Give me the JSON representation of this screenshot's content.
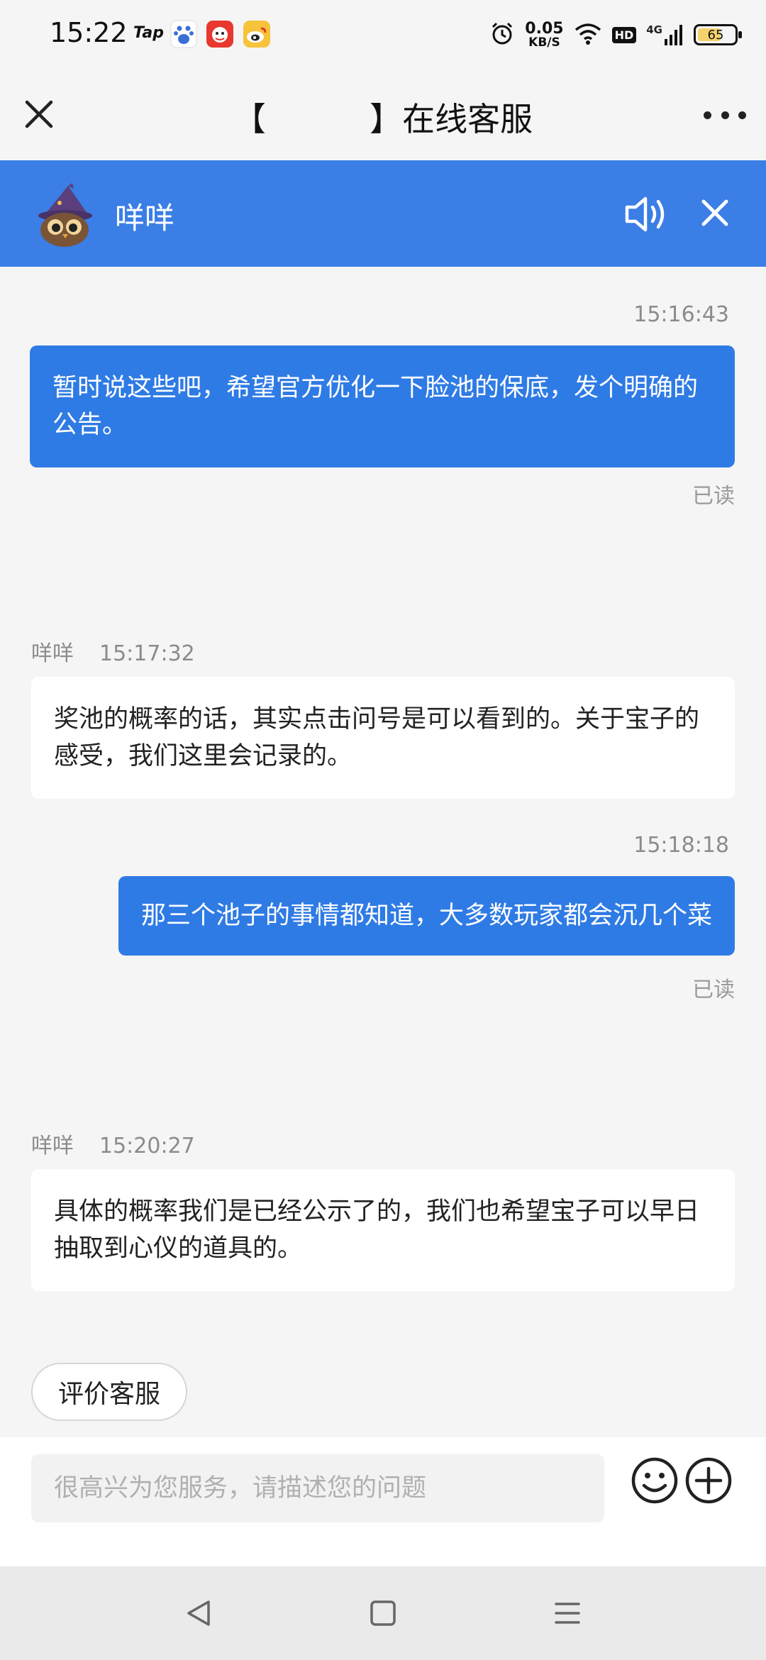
{
  "status_bar": {
    "time": "15:22",
    "tap_label": "Tap",
    "speed_value": "0.05",
    "speed_unit": "KB/S",
    "network": "4G",
    "hd_label": "HD",
    "battery": "65",
    "battery_level": 0.65
  },
  "title_bar": {
    "title": "【          】在线客服"
  },
  "agent": {
    "name": "咩咩"
  },
  "messages": [
    {
      "direction": "out",
      "time": "15:16:43",
      "text": "暂时说这些吧，希望官方优化一下脸池的保底，发个明确的公告。",
      "status": "已读"
    },
    {
      "direction": "in",
      "sender": "咩咩",
      "time": "15:17:32",
      "text": "奖池的概率的话，其实点击问号是可以看到的。关于宝子的感受，我们这里会记录的。"
    },
    {
      "direction": "out",
      "time": "15:18:18",
      "text": "那三个池子的事情都知道，大多数玩家都会沉几个菜",
      "status": "已读"
    },
    {
      "direction": "in",
      "sender": "咩咩",
      "time": "15:20:27",
      "text": "具体的概率我们是已经公示了的，我们也希望宝子可以早日抽取到心仪的道具的。"
    }
  ],
  "rate_button": "评价客服",
  "input": {
    "placeholder": "很高兴为您服务，请描述您的问题",
    "value": ""
  },
  "icons": {
    "close": "close-icon",
    "more": "more-icon",
    "speaker": "speaker-icon",
    "emoji": "emoji-icon",
    "plus": "plus-icon",
    "back": "back-icon",
    "home": "home-icon",
    "menu": "menu-icon"
  },
  "colors": {
    "accent": "#3a7ee6",
    "outgoing_bubble": "#2f7be5",
    "incoming_bubble": "#ffffff",
    "background": "#f5f5f5"
  }
}
